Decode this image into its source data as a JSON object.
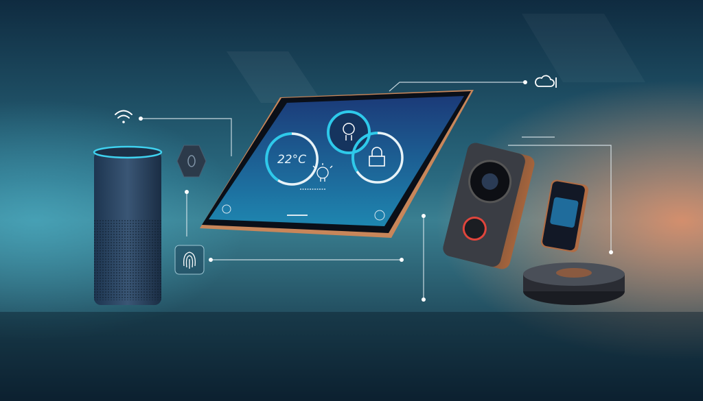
{
  "scene": {
    "thermostat_reading": "22°C"
  },
  "colors": {
    "accent_cyan": "#2ec9ea",
    "glow_orange": "#d88a63",
    "background": "#123a52",
    "doorbell_ring": "#e0453c"
  },
  "icons": [
    "wifi-icon",
    "cloud-icon",
    "fingerprint-icon",
    "hexagon-sensor-icon",
    "lightbulb-icon",
    "lock-icon",
    "camera-icon"
  ]
}
